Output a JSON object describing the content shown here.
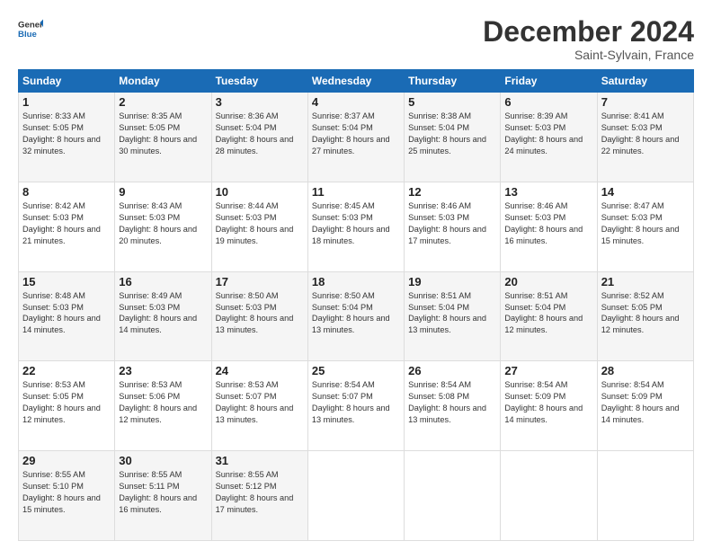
{
  "logo": {
    "line1": "General",
    "line2": "Blue"
  },
  "title": "December 2024",
  "location": "Saint-Sylvain, France",
  "days_header": [
    "Sunday",
    "Monday",
    "Tuesday",
    "Wednesday",
    "Thursday",
    "Friday",
    "Saturday"
  ],
  "weeks": [
    [
      {
        "day": "1",
        "sunrise": "Sunrise: 8:33 AM",
        "sunset": "Sunset: 5:05 PM",
        "daylight": "Daylight: 8 hours and 32 minutes."
      },
      {
        "day": "2",
        "sunrise": "Sunrise: 8:35 AM",
        "sunset": "Sunset: 5:05 PM",
        "daylight": "Daylight: 8 hours and 30 minutes."
      },
      {
        "day": "3",
        "sunrise": "Sunrise: 8:36 AM",
        "sunset": "Sunset: 5:04 PM",
        "daylight": "Daylight: 8 hours and 28 minutes."
      },
      {
        "day": "4",
        "sunrise": "Sunrise: 8:37 AM",
        "sunset": "Sunset: 5:04 PM",
        "daylight": "Daylight: 8 hours and 27 minutes."
      },
      {
        "day": "5",
        "sunrise": "Sunrise: 8:38 AM",
        "sunset": "Sunset: 5:04 PM",
        "daylight": "Daylight: 8 hours and 25 minutes."
      },
      {
        "day": "6",
        "sunrise": "Sunrise: 8:39 AM",
        "sunset": "Sunset: 5:03 PM",
        "daylight": "Daylight: 8 hours and 24 minutes."
      },
      {
        "day": "7",
        "sunrise": "Sunrise: 8:41 AM",
        "sunset": "Sunset: 5:03 PM",
        "daylight": "Daylight: 8 hours and 22 minutes."
      }
    ],
    [
      {
        "day": "8",
        "sunrise": "Sunrise: 8:42 AM",
        "sunset": "Sunset: 5:03 PM",
        "daylight": "Daylight: 8 hours and 21 minutes."
      },
      {
        "day": "9",
        "sunrise": "Sunrise: 8:43 AM",
        "sunset": "Sunset: 5:03 PM",
        "daylight": "Daylight: 8 hours and 20 minutes."
      },
      {
        "day": "10",
        "sunrise": "Sunrise: 8:44 AM",
        "sunset": "Sunset: 5:03 PM",
        "daylight": "Daylight: 8 hours and 19 minutes."
      },
      {
        "day": "11",
        "sunrise": "Sunrise: 8:45 AM",
        "sunset": "Sunset: 5:03 PM",
        "daylight": "Daylight: 8 hours and 18 minutes."
      },
      {
        "day": "12",
        "sunrise": "Sunrise: 8:46 AM",
        "sunset": "Sunset: 5:03 PM",
        "daylight": "Daylight: 8 hours and 17 minutes."
      },
      {
        "day": "13",
        "sunrise": "Sunrise: 8:46 AM",
        "sunset": "Sunset: 5:03 PM",
        "daylight": "Daylight: 8 hours and 16 minutes."
      },
      {
        "day": "14",
        "sunrise": "Sunrise: 8:47 AM",
        "sunset": "Sunset: 5:03 PM",
        "daylight": "Daylight: 8 hours and 15 minutes."
      }
    ],
    [
      {
        "day": "15",
        "sunrise": "Sunrise: 8:48 AM",
        "sunset": "Sunset: 5:03 PM",
        "daylight": "Daylight: 8 hours and 14 minutes."
      },
      {
        "day": "16",
        "sunrise": "Sunrise: 8:49 AM",
        "sunset": "Sunset: 5:03 PM",
        "daylight": "Daylight: 8 hours and 14 minutes."
      },
      {
        "day": "17",
        "sunrise": "Sunrise: 8:50 AM",
        "sunset": "Sunset: 5:03 PM",
        "daylight": "Daylight: 8 hours and 13 minutes."
      },
      {
        "day": "18",
        "sunrise": "Sunrise: 8:50 AM",
        "sunset": "Sunset: 5:04 PM",
        "daylight": "Daylight: 8 hours and 13 minutes."
      },
      {
        "day": "19",
        "sunrise": "Sunrise: 8:51 AM",
        "sunset": "Sunset: 5:04 PM",
        "daylight": "Daylight: 8 hours and 13 minutes."
      },
      {
        "day": "20",
        "sunrise": "Sunrise: 8:51 AM",
        "sunset": "Sunset: 5:04 PM",
        "daylight": "Daylight: 8 hours and 12 minutes."
      },
      {
        "day": "21",
        "sunrise": "Sunrise: 8:52 AM",
        "sunset": "Sunset: 5:05 PM",
        "daylight": "Daylight: 8 hours and 12 minutes."
      }
    ],
    [
      {
        "day": "22",
        "sunrise": "Sunrise: 8:53 AM",
        "sunset": "Sunset: 5:05 PM",
        "daylight": "Daylight: 8 hours and 12 minutes."
      },
      {
        "day": "23",
        "sunrise": "Sunrise: 8:53 AM",
        "sunset": "Sunset: 5:06 PM",
        "daylight": "Daylight: 8 hours and 12 minutes."
      },
      {
        "day": "24",
        "sunrise": "Sunrise: 8:53 AM",
        "sunset": "Sunset: 5:07 PM",
        "daylight": "Daylight: 8 hours and 13 minutes."
      },
      {
        "day": "25",
        "sunrise": "Sunrise: 8:54 AM",
        "sunset": "Sunset: 5:07 PM",
        "daylight": "Daylight: 8 hours and 13 minutes."
      },
      {
        "day": "26",
        "sunrise": "Sunrise: 8:54 AM",
        "sunset": "Sunset: 5:08 PM",
        "daylight": "Daylight: 8 hours and 13 minutes."
      },
      {
        "day": "27",
        "sunrise": "Sunrise: 8:54 AM",
        "sunset": "Sunset: 5:09 PM",
        "daylight": "Daylight: 8 hours and 14 minutes."
      },
      {
        "day": "28",
        "sunrise": "Sunrise: 8:54 AM",
        "sunset": "Sunset: 5:09 PM",
        "daylight": "Daylight: 8 hours and 14 minutes."
      }
    ],
    [
      {
        "day": "29",
        "sunrise": "Sunrise: 8:55 AM",
        "sunset": "Sunset: 5:10 PM",
        "daylight": "Daylight: 8 hours and 15 minutes."
      },
      {
        "day": "30",
        "sunrise": "Sunrise: 8:55 AM",
        "sunset": "Sunset: 5:11 PM",
        "daylight": "Daylight: 8 hours and 16 minutes."
      },
      {
        "day": "31",
        "sunrise": "Sunrise: 8:55 AM",
        "sunset": "Sunset: 5:12 PM",
        "daylight": "Daylight: 8 hours and 17 minutes."
      },
      null,
      null,
      null,
      null
    ]
  ]
}
